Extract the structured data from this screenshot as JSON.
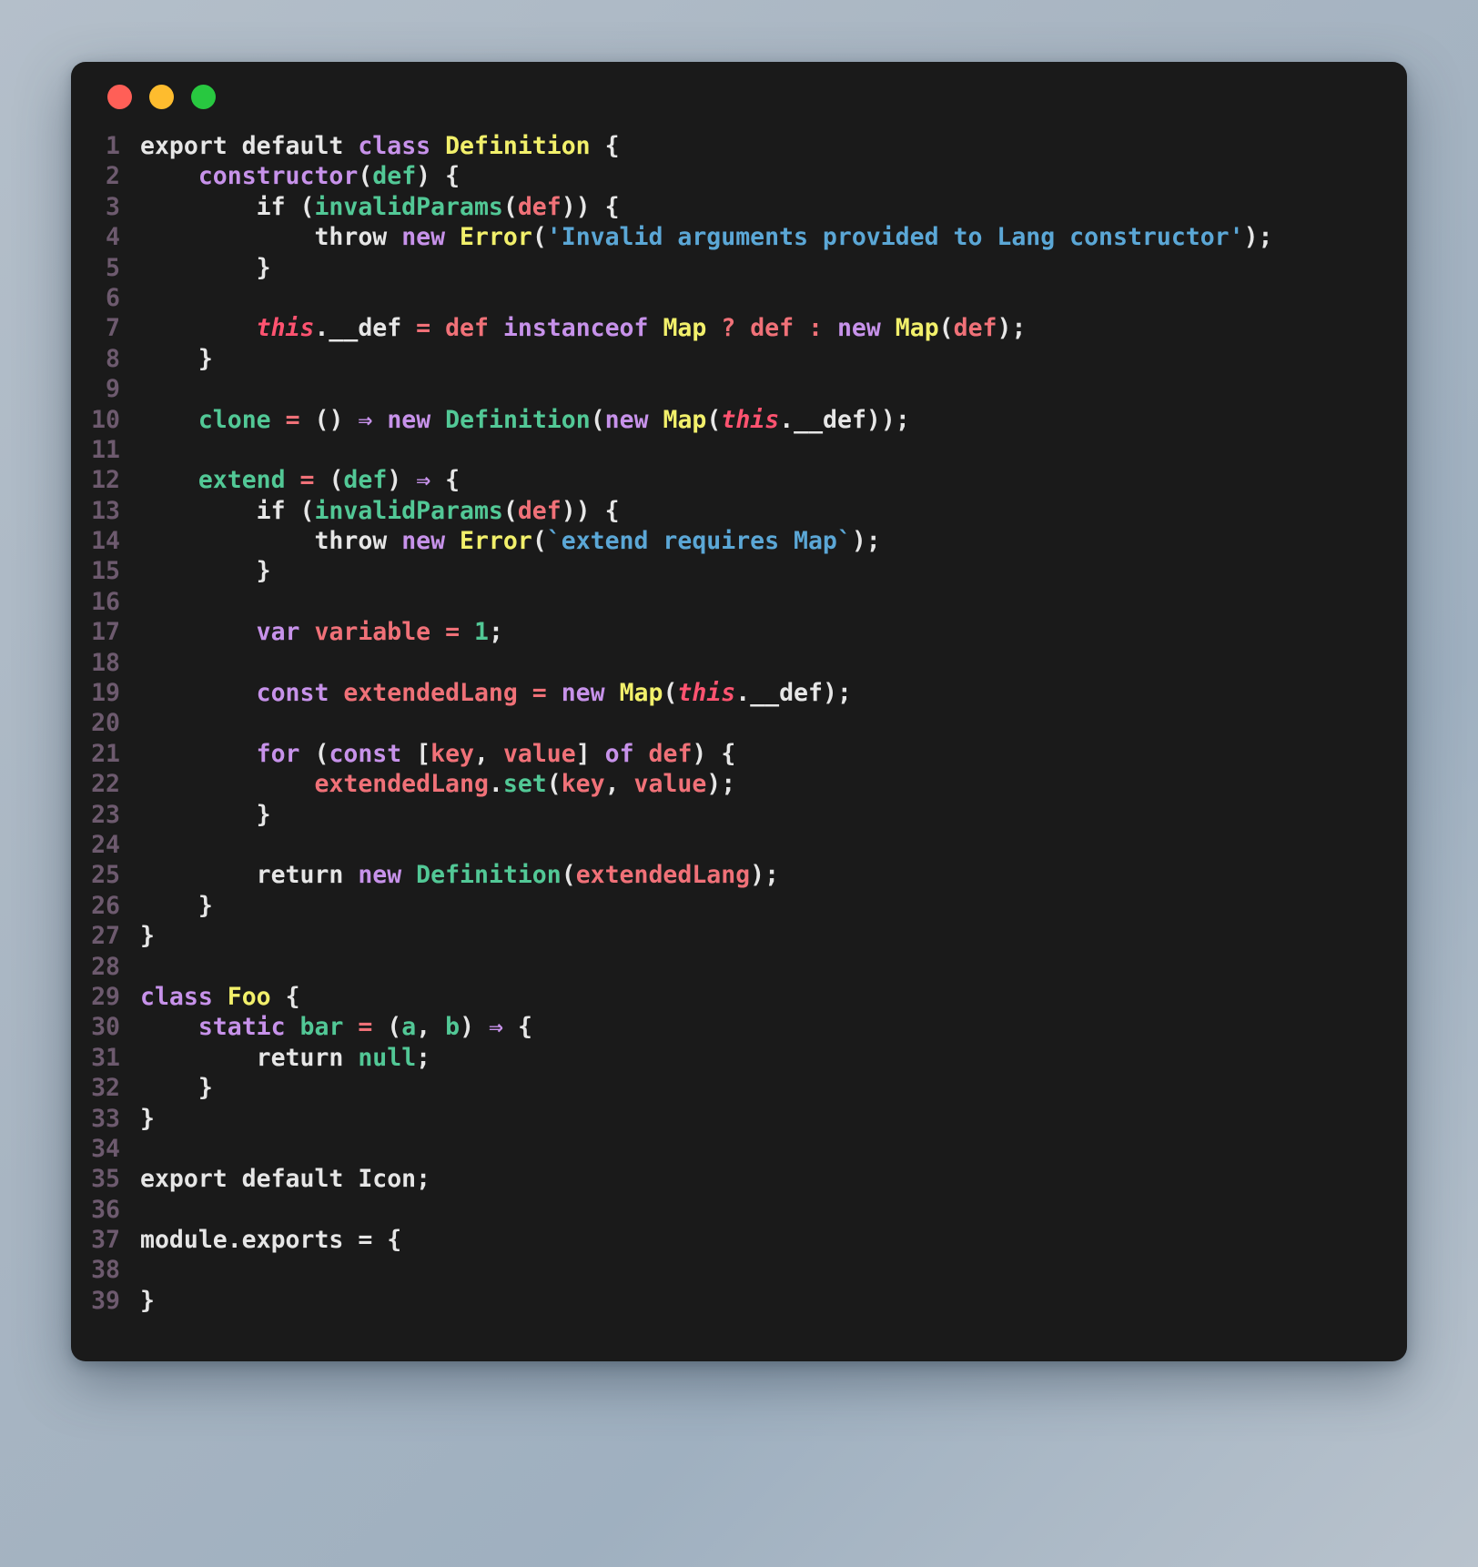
{
  "window": {
    "traffic_lights": [
      {
        "name": "close",
        "color": "#ff5f57"
      },
      {
        "name": "minimize",
        "color": "#febc2e"
      },
      {
        "name": "maximize",
        "color": "#28c840"
      }
    ],
    "background": "#1a1a1a"
  },
  "editor": {
    "language": "javascript",
    "line_number_color": "#6d5a6e",
    "first_line": 1,
    "last_line": 39,
    "lines": [
      {
        "n": "1",
        "tokens": [
          {
            "t": "export default ",
            "c": "plain"
          },
          {
            "t": "class",
            "c": "key"
          },
          {
            "t": " ",
            "c": "plain"
          },
          {
            "t": "Definition",
            "c": "cls"
          },
          {
            "t": " {",
            "c": "plain"
          }
        ]
      },
      {
        "n": "2",
        "tokens": [
          {
            "t": "    ",
            "c": "plain"
          },
          {
            "t": "constructor",
            "c": "key"
          },
          {
            "t": "(",
            "c": "plain"
          },
          {
            "t": "def",
            "c": "fn"
          },
          {
            "t": ") {",
            "c": "plain"
          }
        ]
      },
      {
        "n": "3",
        "tokens": [
          {
            "t": "        if (",
            "c": "plain"
          },
          {
            "t": "invalidParams",
            "c": "fn"
          },
          {
            "t": "(",
            "c": "plain"
          },
          {
            "t": "def",
            "c": "var"
          },
          {
            "t": ")) {",
            "c": "plain"
          }
        ]
      },
      {
        "n": "4",
        "tokens": [
          {
            "t": "            throw ",
            "c": "plain"
          },
          {
            "t": "new",
            "c": "key"
          },
          {
            "t": " ",
            "c": "plain"
          },
          {
            "t": "Error",
            "c": "cls"
          },
          {
            "t": "(",
            "c": "plain"
          },
          {
            "t": "'Invalid arguments provided to Lang constructor'",
            "c": "str"
          },
          {
            "t": ");",
            "c": "plain"
          }
        ]
      },
      {
        "n": "5",
        "tokens": [
          {
            "t": "        }",
            "c": "plain"
          }
        ]
      },
      {
        "n": "6",
        "tokens": []
      },
      {
        "n": "7",
        "tokens": [
          {
            "t": "        ",
            "c": "plain"
          },
          {
            "t": "this",
            "c": "this"
          },
          {
            "t": ".__def",
            "c": "plain"
          },
          {
            "t": " = ",
            "c": "op"
          },
          {
            "t": "def",
            "c": "var"
          },
          {
            "t": " ",
            "c": "plain"
          },
          {
            "t": "instanceof",
            "c": "key"
          },
          {
            "t": " ",
            "c": "plain"
          },
          {
            "t": "Map",
            "c": "cls"
          },
          {
            "t": " ? ",
            "c": "op"
          },
          {
            "t": "def",
            "c": "var"
          },
          {
            "t": " : ",
            "c": "op"
          },
          {
            "t": "new",
            "c": "key"
          },
          {
            "t": " ",
            "c": "plain"
          },
          {
            "t": "Map",
            "c": "cls"
          },
          {
            "t": "(",
            "c": "plain"
          },
          {
            "t": "def",
            "c": "var"
          },
          {
            "t": ");",
            "c": "plain"
          }
        ]
      },
      {
        "n": "8",
        "tokens": [
          {
            "t": "    }",
            "c": "plain"
          }
        ]
      },
      {
        "n": "9",
        "tokens": []
      },
      {
        "n": "10",
        "tokens": [
          {
            "t": "    ",
            "c": "plain"
          },
          {
            "t": "clone",
            "c": "fn"
          },
          {
            "t": " = ",
            "c": "op"
          },
          {
            "t": "()",
            "c": "plain"
          },
          {
            "t": " ",
            "c": "plain"
          },
          {
            "t": "⇒",
            "c": "arrow"
          },
          {
            "t": " ",
            "c": "plain"
          },
          {
            "t": "new",
            "c": "key"
          },
          {
            "t": " ",
            "c": "plain"
          },
          {
            "t": "Definition",
            "c": "fn"
          },
          {
            "t": "(",
            "c": "plain"
          },
          {
            "t": "new",
            "c": "key"
          },
          {
            "t": " ",
            "c": "plain"
          },
          {
            "t": "Map",
            "c": "cls"
          },
          {
            "t": "(",
            "c": "plain"
          },
          {
            "t": "this",
            "c": "this"
          },
          {
            "t": ".__def",
            "c": "plain"
          },
          {
            "t": "));",
            "c": "plain"
          }
        ]
      },
      {
        "n": "11",
        "tokens": []
      },
      {
        "n": "12",
        "tokens": [
          {
            "t": "    ",
            "c": "plain"
          },
          {
            "t": "extend",
            "c": "fn"
          },
          {
            "t": " = ",
            "c": "op"
          },
          {
            "t": "(",
            "c": "plain"
          },
          {
            "t": "def",
            "c": "fn"
          },
          {
            "t": ")",
            "c": "plain"
          },
          {
            "t": " ",
            "c": "plain"
          },
          {
            "t": "⇒",
            "c": "arrow"
          },
          {
            "t": " {",
            "c": "plain"
          }
        ]
      },
      {
        "n": "13",
        "tokens": [
          {
            "t": "        if (",
            "c": "plain"
          },
          {
            "t": "invalidParams",
            "c": "fn"
          },
          {
            "t": "(",
            "c": "plain"
          },
          {
            "t": "def",
            "c": "var"
          },
          {
            "t": ")) {",
            "c": "plain"
          }
        ]
      },
      {
        "n": "14",
        "tokens": [
          {
            "t": "            throw ",
            "c": "plain"
          },
          {
            "t": "new",
            "c": "key"
          },
          {
            "t": " ",
            "c": "plain"
          },
          {
            "t": "Error",
            "c": "cls"
          },
          {
            "t": "(",
            "c": "plain"
          },
          {
            "t": "`extend requires Map`",
            "c": "str"
          },
          {
            "t": ");",
            "c": "plain"
          }
        ]
      },
      {
        "n": "15",
        "tokens": [
          {
            "t": "        }",
            "c": "plain"
          }
        ]
      },
      {
        "n": "16",
        "tokens": []
      },
      {
        "n": "17",
        "tokens": [
          {
            "t": "        ",
            "c": "plain"
          },
          {
            "t": "var",
            "c": "key"
          },
          {
            "t": " ",
            "c": "plain"
          },
          {
            "t": "variable",
            "c": "var"
          },
          {
            "t": " = ",
            "c": "op"
          },
          {
            "t": "1",
            "c": "num"
          },
          {
            "t": ";",
            "c": "plain"
          }
        ]
      },
      {
        "n": "18",
        "tokens": []
      },
      {
        "n": "19",
        "tokens": [
          {
            "t": "        ",
            "c": "plain"
          },
          {
            "t": "const",
            "c": "key"
          },
          {
            "t": " ",
            "c": "plain"
          },
          {
            "t": "extendedLang",
            "c": "var"
          },
          {
            "t": " = ",
            "c": "op"
          },
          {
            "t": "new",
            "c": "key"
          },
          {
            "t": " ",
            "c": "plain"
          },
          {
            "t": "Map",
            "c": "cls"
          },
          {
            "t": "(",
            "c": "plain"
          },
          {
            "t": "this",
            "c": "this"
          },
          {
            "t": ".__def",
            "c": "plain"
          },
          {
            "t": ");",
            "c": "plain"
          }
        ]
      },
      {
        "n": "20",
        "tokens": []
      },
      {
        "n": "21",
        "tokens": [
          {
            "t": "        ",
            "c": "plain"
          },
          {
            "t": "for",
            "c": "key"
          },
          {
            "t": " (",
            "c": "plain"
          },
          {
            "t": "const",
            "c": "key"
          },
          {
            "t": " [",
            "c": "plain"
          },
          {
            "t": "key",
            "c": "var"
          },
          {
            "t": ", ",
            "c": "plain"
          },
          {
            "t": "value",
            "c": "var"
          },
          {
            "t": "] ",
            "c": "plain"
          },
          {
            "t": "of",
            "c": "key"
          },
          {
            "t": " ",
            "c": "plain"
          },
          {
            "t": "def",
            "c": "var"
          },
          {
            "t": ") {",
            "c": "plain"
          }
        ]
      },
      {
        "n": "22",
        "tokens": [
          {
            "t": "            ",
            "c": "plain"
          },
          {
            "t": "extendedLang",
            "c": "var"
          },
          {
            "t": ".",
            "c": "plain"
          },
          {
            "t": "set",
            "c": "fn"
          },
          {
            "t": "(",
            "c": "plain"
          },
          {
            "t": "key",
            "c": "var"
          },
          {
            "t": ", ",
            "c": "plain"
          },
          {
            "t": "value",
            "c": "var"
          },
          {
            "t": ");",
            "c": "plain"
          }
        ]
      },
      {
        "n": "23",
        "tokens": [
          {
            "t": "        }",
            "c": "plain"
          }
        ]
      },
      {
        "n": "24",
        "tokens": []
      },
      {
        "n": "25",
        "tokens": [
          {
            "t": "        return ",
            "c": "plain"
          },
          {
            "t": "new",
            "c": "key"
          },
          {
            "t": " ",
            "c": "plain"
          },
          {
            "t": "Definition",
            "c": "fn"
          },
          {
            "t": "(",
            "c": "plain"
          },
          {
            "t": "extendedLang",
            "c": "var"
          },
          {
            "t": ");",
            "c": "plain"
          }
        ]
      },
      {
        "n": "26",
        "tokens": [
          {
            "t": "    }",
            "c": "plain"
          }
        ]
      },
      {
        "n": "27",
        "tokens": [
          {
            "t": "}",
            "c": "plain"
          }
        ]
      },
      {
        "n": "28",
        "tokens": []
      },
      {
        "n": "29",
        "tokens": [
          {
            "t": "class",
            "c": "key"
          },
          {
            "t": " ",
            "c": "plain"
          },
          {
            "t": "Foo",
            "c": "cls"
          },
          {
            "t": " {",
            "c": "plain"
          }
        ]
      },
      {
        "n": "30",
        "tokens": [
          {
            "t": "    ",
            "c": "plain"
          },
          {
            "t": "static",
            "c": "key"
          },
          {
            "t": " ",
            "c": "plain"
          },
          {
            "t": "bar",
            "c": "fn"
          },
          {
            "t": " = ",
            "c": "op"
          },
          {
            "t": "(",
            "c": "plain"
          },
          {
            "t": "a",
            "c": "fn"
          },
          {
            "t": ", ",
            "c": "plain"
          },
          {
            "t": "b",
            "c": "fn"
          },
          {
            "t": ")",
            "c": "plain"
          },
          {
            "t": " ",
            "c": "plain"
          },
          {
            "t": "⇒",
            "c": "arrow"
          },
          {
            "t": " {",
            "c": "plain"
          }
        ]
      },
      {
        "n": "31",
        "tokens": [
          {
            "t": "        return ",
            "c": "plain"
          },
          {
            "t": "null",
            "c": "fn"
          },
          {
            "t": ";",
            "c": "plain"
          }
        ]
      },
      {
        "n": "32",
        "tokens": [
          {
            "t": "    }",
            "c": "plain"
          }
        ]
      },
      {
        "n": "33",
        "tokens": [
          {
            "t": "}",
            "c": "plain"
          }
        ]
      },
      {
        "n": "34",
        "tokens": []
      },
      {
        "n": "35",
        "tokens": [
          {
            "t": "export default Icon;",
            "c": "plain"
          }
        ]
      },
      {
        "n": "36",
        "tokens": []
      },
      {
        "n": "37",
        "tokens": [
          {
            "t": "module.exports = {",
            "c": "plain"
          }
        ]
      },
      {
        "n": "38",
        "tokens": []
      },
      {
        "n": "39",
        "tokens": [
          {
            "t": "}",
            "c": "plain"
          }
        ]
      }
    ]
  },
  "theme": {
    "plain": "#e6e6e6",
    "keyword": "#c792ea",
    "class": "#f2f06b",
    "function": "#52c896",
    "variable": "#f07178",
    "string": "#5ba7d6",
    "this": "#ff5370",
    "number": "#52c896"
  }
}
